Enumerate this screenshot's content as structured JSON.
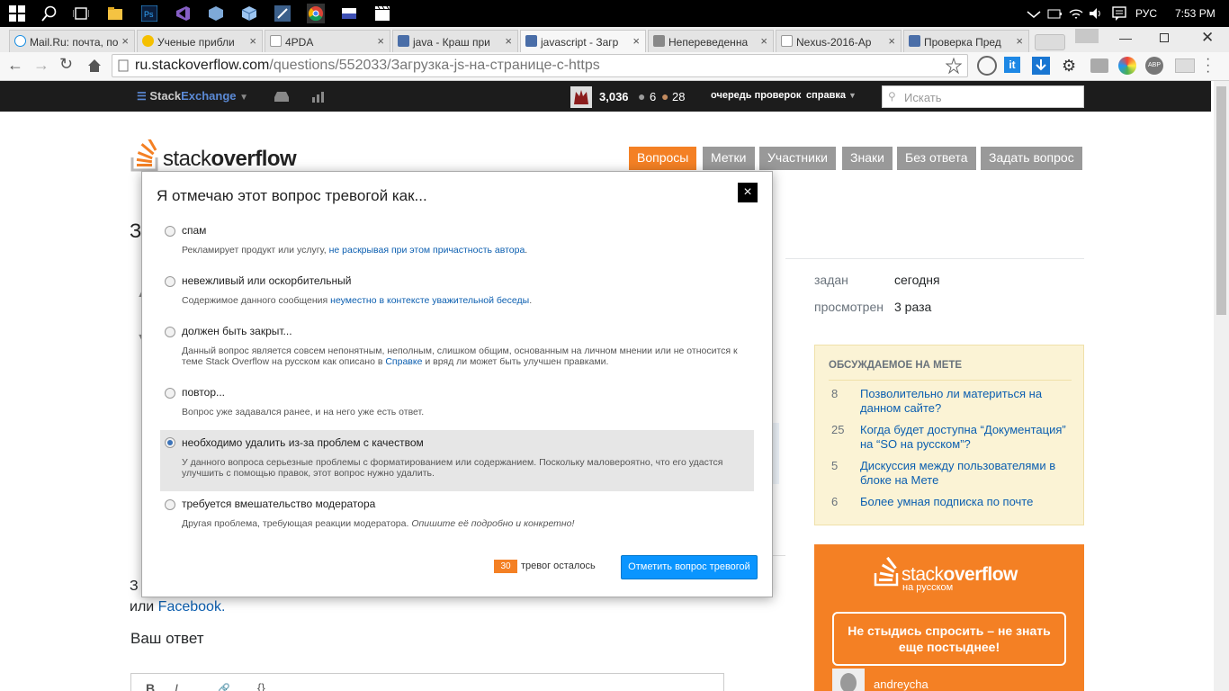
{
  "taskbar": {
    "lang": "РУС",
    "time": "7:53 PM"
  },
  "tabs": [
    {
      "label": "Mail.Ru: почта, по"
    },
    {
      "label": "Ученые прибли"
    },
    {
      "label": "4PDA"
    },
    {
      "label": "java - Краш при"
    },
    {
      "label": "javascript - Загр"
    },
    {
      "label": "Непереведенна"
    },
    {
      "label": "Nexus-2016-Ар"
    },
    {
      "label": "Проверка Пред"
    }
  ],
  "address": {
    "domain": "ru.stackoverflow.com",
    "path": "/questions/552033/Загрузка-js-на-странице-с-https"
  },
  "topbar": {
    "brand_a": "Stack",
    "brand_b": "Exchange",
    "rep": "3,036",
    "silver": "6",
    "bronze": "28",
    "review": "очередь проверок",
    "help": "справка",
    "search_placeholder": "Искать"
  },
  "site": {
    "logo_a": "stack",
    "logo_b": "overflow"
  },
  "nav": [
    "Вопросы",
    "Метки",
    "Участники",
    "Знаки",
    "Без ответа",
    "Задать вопрос"
  ],
  "sidebar": {
    "asked_label": "задан",
    "asked_value": "сегодня",
    "viewed_label": "просмотрен",
    "viewed_value": "3 раза",
    "meta_title": "ОБСУЖДАЕМОЕ НА МЕТЕ",
    "meta_items": [
      {
        "count": "8",
        "text": "Позволительно ли материться на данном сайте?"
      },
      {
        "count": "25",
        "text": "Когда будет доступна “Документация” на “SO на русском”?"
      },
      {
        "count": "5",
        "text": "Дискуссия между пользователями в блоке на Мете"
      },
      {
        "count": "6",
        "text": "Более умная подписка по почте"
      }
    ],
    "ad_logo_a": "stack",
    "ad_logo_b": "overflow",
    "ad_sub": "на русском",
    "ad_slogan": "Не стыдись спросить – не знать еще постыднее!",
    "ad_user": "andreycha"
  },
  "page": {
    "question_initial": "З",
    "login_prefix": "З",
    "login_or": "или",
    "login_facebook": "Facebook.",
    "your_answer": "Ваш ответ"
  },
  "modal": {
    "title": "Я отмечаю этот вопрос тревогой как...",
    "close": "×",
    "options": [
      {
        "title": "спам",
        "desc": "Рекламирует продукт или услугу,",
        "link": "не раскрывая при этом причастность автора",
        "desc_end": "."
      },
      {
        "title": "невежливый или оскорбительный",
        "desc": "Содержимое данного сообщения",
        "link": "неуместно в контексте уважительной беседы",
        "desc_end": "."
      },
      {
        "title": "должен быть закрыт...",
        "desc": "Данный вопрос является совсем непонятным, неполным, слишком общим, основанным на личном мнении или не относится к теме Stack Overflow на русском как описано в",
        "link": "Справке",
        "desc_end": "и вряд ли может быть улучшен правками."
      },
      {
        "title": "повтор...",
        "desc": "Вопрос уже задавался ранее, и на него уже есть ответ.",
        "link": "",
        "desc_end": ""
      },
      {
        "title": "необходимо удалить из-за проблем с качеством",
        "desc": "У данного вопроса серьезные проблемы с форматированием или содержанием. Поскольку маловероятно, что его удастся улучшить с помощью правок, этот вопрос нужно удалить.",
        "link": "",
        "desc_end": ""
      },
      {
        "title": "требуется вмешательство модератора",
        "desc": "Другая проблема, требующая реакции модератора.",
        "link": "",
        "desc_end": "Опишите её подробно и конкретно!"
      }
    ],
    "selected_index": 4,
    "flags_count": "30",
    "flags_left": "тревог осталось",
    "submit": "Отметить вопрос тревогой"
  },
  "colors": {
    "accent": "#f48024",
    "link": "#0c5fb0",
    "submit_bg": "#0a95ff",
    "topbar": "#1c1c1c"
  }
}
